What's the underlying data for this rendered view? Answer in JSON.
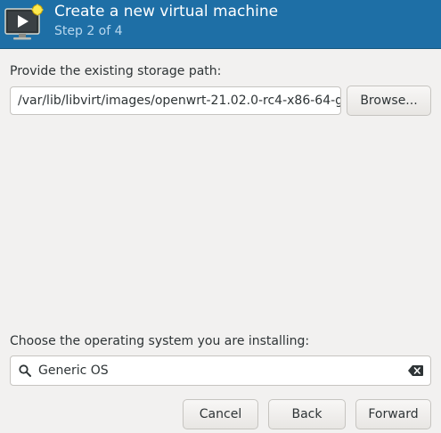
{
  "header": {
    "title": "Create a new virtual machine",
    "subtitle": "Step 2 of 4",
    "icon": "vm-monitor-play-icon",
    "background_color": "#1e6fa6"
  },
  "storage": {
    "label": "Provide the existing storage path:",
    "path_value": "/var/lib/libvirt/images/openwrt-21.02.0-rc4-x86-64-g",
    "browse_label": "Browse..."
  },
  "os": {
    "label": "Choose the operating system you are installing:",
    "value": "Generic OS",
    "search_icon": "search-icon",
    "clear_icon": "clear-icon"
  },
  "footer": {
    "cancel_label": "Cancel",
    "back_label": "Back",
    "forward_label": "Forward"
  }
}
